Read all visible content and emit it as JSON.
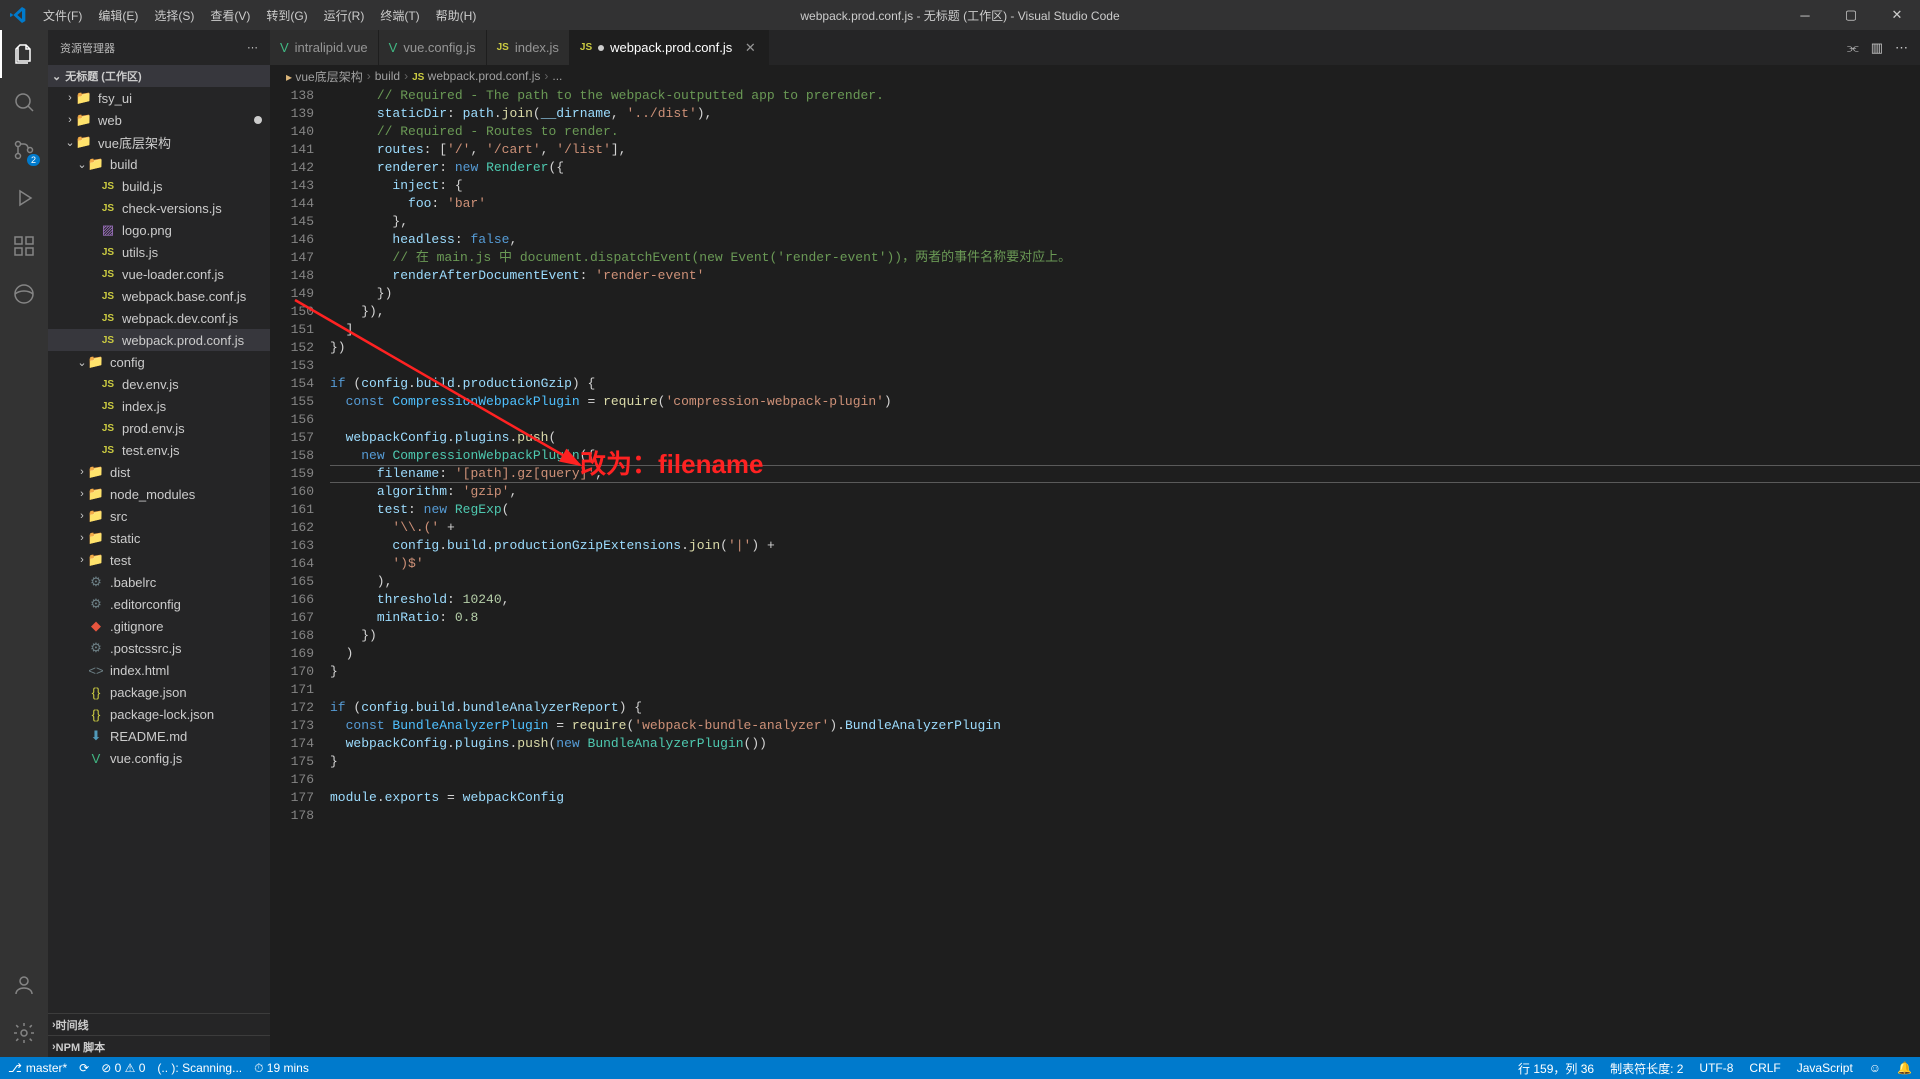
{
  "menubar": [
    "文件(F)",
    "编辑(E)",
    "选择(S)",
    "查看(V)",
    "转到(G)",
    "运行(R)",
    "终端(T)",
    "帮助(H)"
  ],
  "title": "webpack.prod.conf.js - 无标题 (工作区) - Visual Studio Code",
  "sidebar": {
    "header": "资源管理器",
    "section": "无标题 (工作区)",
    "bottom1": "时间线",
    "bottom2": "NPM 脚本"
  },
  "tree": [
    {
      "indent": 1,
      "chev": "›",
      "type": "folder",
      "label": "fsy_ui"
    },
    {
      "indent": 1,
      "chev": "›",
      "type": "folder",
      "label": "web",
      "mod": true
    },
    {
      "indent": 1,
      "chev": "⌄",
      "type": "folder",
      "label": "vue底层架构"
    },
    {
      "indent": 2,
      "chev": "⌄",
      "type": "folder",
      "label": "build"
    },
    {
      "indent": 3,
      "type": "js",
      "label": "build.js"
    },
    {
      "indent": 3,
      "type": "js",
      "label": "check-versions.js"
    },
    {
      "indent": 3,
      "type": "img",
      "label": "logo.png"
    },
    {
      "indent": 3,
      "type": "js",
      "label": "utils.js"
    },
    {
      "indent": 3,
      "type": "js",
      "label": "vue-loader.conf.js"
    },
    {
      "indent": 3,
      "type": "js",
      "label": "webpack.base.conf.js"
    },
    {
      "indent": 3,
      "type": "js",
      "label": "webpack.dev.conf.js"
    },
    {
      "indent": 3,
      "type": "js",
      "label": "webpack.prod.conf.js",
      "active": true
    },
    {
      "indent": 2,
      "chev": "⌄",
      "type": "folder",
      "label": "config"
    },
    {
      "indent": 3,
      "type": "js",
      "label": "dev.env.js"
    },
    {
      "indent": 3,
      "type": "js",
      "label": "index.js"
    },
    {
      "indent": 3,
      "type": "js",
      "label": "prod.env.js"
    },
    {
      "indent": 3,
      "type": "js",
      "label": "test.env.js"
    },
    {
      "indent": 2,
      "chev": "›",
      "type": "folder",
      "label": "dist"
    },
    {
      "indent": 2,
      "chev": "›",
      "type": "folder",
      "label": "node_modules"
    },
    {
      "indent": 2,
      "chev": "›",
      "type": "folder",
      "label": "src"
    },
    {
      "indent": 2,
      "chev": "›",
      "type": "folder",
      "label": "static"
    },
    {
      "indent": 2,
      "chev": "›",
      "type": "folder",
      "label": "test"
    },
    {
      "indent": 2,
      "type": "conf",
      "label": ".babelrc"
    },
    {
      "indent": 2,
      "type": "conf",
      "label": ".editorconfig"
    },
    {
      "indent": 2,
      "type": "git",
      "label": ".gitignore"
    },
    {
      "indent": 2,
      "type": "conf",
      "label": ".postcssrc.js"
    },
    {
      "indent": 2,
      "type": "html",
      "label": "index.html"
    },
    {
      "indent": 2,
      "type": "json",
      "label": "package.json"
    },
    {
      "indent": 2,
      "type": "json",
      "label": "package-lock.json"
    },
    {
      "indent": 2,
      "type": "md",
      "label": "README.md"
    },
    {
      "indent": 2,
      "type": "vue",
      "label": "vue.config.js"
    }
  ],
  "tabs": [
    {
      "icon": "vue",
      "label": "intralipid.vue"
    },
    {
      "icon": "vue",
      "label": "vue.config.js"
    },
    {
      "icon": "js",
      "label": "index.js"
    },
    {
      "icon": "js",
      "label": "webpack.prod.conf.js",
      "active": true,
      "close": true,
      "dot": true
    }
  ],
  "breadcrumbs": [
    "vue底层架构",
    "build",
    "webpack.prod.conf.js",
    "..."
  ],
  "code_start": 138,
  "code": [
    [
      [
        "      ",
        "d"
      ],
      [
        "// Required - The path to the webpack-outputted app to prerender.",
        "comment"
      ]
    ],
    [
      [
        "      ",
        "d"
      ],
      [
        "staticDir",
        "prop"
      ],
      [
        ": ",
        "d"
      ],
      [
        "path",
        "prop"
      ],
      [
        ".",
        "d"
      ],
      [
        "join",
        "func"
      ],
      [
        "(",
        "d"
      ],
      [
        "__dirname",
        "prop"
      ],
      [
        ", ",
        "d"
      ],
      [
        "'../dist'",
        "string"
      ],
      [
        "),",
        "d"
      ]
    ],
    [
      [
        "      ",
        "d"
      ],
      [
        "// Required - Routes to render.",
        "comment"
      ]
    ],
    [
      [
        "      ",
        "d"
      ],
      [
        "routes",
        "prop"
      ],
      [
        ": [",
        "d"
      ],
      [
        "'/'",
        "string"
      ],
      [
        ", ",
        "d"
      ],
      [
        "'/cart'",
        "string"
      ],
      [
        ", ",
        "d"
      ],
      [
        "'/list'",
        "string"
      ],
      [
        "],",
        "d"
      ]
    ],
    [
      [
        "      ",
        "d"
      ],
      [
        "renderer",
        "prop"
      ],
      [
        ": ",
        "d"
      ],
      [
        "new ",
        "keyword"
      ],
      [
        "Renderer",
        "type"
      ],
      [
        "({",
        "d"
      ]
    ],
    [
      [
        "        ",
        "d"
      ],
      [
        "inject",
        "prop"
      ],
      [
        ": {",
        "d"
      ]
    ],
    [
      [
        "          ",
        "d"
      ],
      [
        "foo",
        "prop"
      ],
      [
        ": ",
        "d"
      ],
      [
        "'bar'",
        "string"
      ]
    ],
    [
      [
        "        },",
        "d"
      ]
    ],
    [
      [
        "        ",
        "d"
      ],
      [
        "headless",
        "prop"
      ],
      [
        ": ",
        "d"
      ],
      [
        "false",
        "keyword"
      ],
      [
        ",",
        "d"
      ]
    ],
    [
      [
        "        ",
        "d"
      ],
      [
        "// 在 main.js 中 document.dispatchEvent(new Event('render-event'))，两者的事件名称要对应上。",
        "comment"
      ]
    ],
    [
      [
        "        ",
        "d"
      ],
      [
        "renderAfterDocumentEvent",
        "prop"
      ],
      [
        ": ",
        "d"
      ],
      [
        "'render-event'",
        "string"
      ]
    ],
    [
      [
        "      })",
        "d"
      ]
    ],
    [
      [
        "    }),",
        "d"
      ]
    ],
    [
      [
        "  ]",
        "d"
      ]
    ],
    [
      [
        "})",
        "d"
      ]
    ],
    [
      [
        "",
        "d"
      ]
    ],
    [
      [
        "if ",
        "keyword"
      ],
      [
        "(",
        "d"
      ],
      [
        "config",
        "prop"
      ],
      [
        ".",
        "d"
      ],
      [
        "build",
        "prop"
      ],
      [
        ".",
        "d"
      ],
      [
        "productionGzip",
        "prop"
      ],
      [
        ") {",
        "d"
      ]
    ],
    [
      [
        "  ",
        "d"
      ],
      [
        "const ",
        "keyword"
      ],
      [
        "CompressionWebpackPlugin",
        "const"
      ],
      [
        " = ",
        "d"
      ],
      [
        "require",
        "func"
      ],
      [
        "(",
        "d"
      ],
      [
        "'compression-webpack-plugin'",
        "string"
      ],
      [
        ")",
        "d"
      ]
    ],
    [
      [
        "",
        "d"
      ]
    ],
    [
      [
        "  ",
        "d"
      ],
      [
        "webpackConfig",
        "prop"
      ],
      [
        ".",
        "d"
      ],
      [
        "plugins",
        "prop"
      ],
      [
        ".",
        "d"
      ],
      [
        "push",
        "func"
      ],
      [
        "(",
        "d"
      ]
    ],
    [
      [
        "    ",
        "d"
      ],
      [
        "new ",
        "keyword"
      ],
      [
        "CompressionWebpackPlugin",
        "type"
      ],
      [
        "({",
        "d"
      ]
    ],
    [
      [
        "      ",
        "d"
      ],
      [
        "filename",
        "prop"
      ],
      [
        ": ",
        "d"
      ],
      [
        "'[path].gz[query]'",
        "string"
      ],
      [
        ",",
        "d"
      ]
    ],
    [
      [
        "      ",
        "d"
      ],
      [
        "algorithm",
        "prop"
      ],
      [
        ": ",
        "d"
      ],
      [
        "'gzip'",
        "string"
      ],
      [
        ",",
        "d"
      ]
    ],
    [
      [
        "      ",
        "d"
      ],
      [
        "test",
        "prop"
      ],
      [
        ": ",
        "d"
      ],
      [
        "new ",
        "keyword"
      ],
      [
        "RegExp",
        "type"
      ],
      [
        "(",
        "d"
      ]
    ],
    [
      [
        "        ",
        "d"
      ],
      [
        "'\\\\.(' ",
        "string"
      ],
      [
        "+",
        "d"
      ]
    ],
    [
      [
        "        ",
        "d"
      ],
      [
        "config",
        "prop"
      ],
      [
        ".",
        "d"
      ],
      [
        "build",
        "prop"
      ],
      [
        ".",
        "d"
      ],
      [
        "productionGzipExtensions",
        "prop"
      ],
      [
        ".",
        "d"
      ],
      [
        "join",
        "func"
      ],
      [
        "(",
        "d"
      ],
      [
        "'|'",
        "string"
      ],
      [
        ") +",
        "d"
      ]
    ],
    [
      [
        "        ",
        "d"
      ],
      [
        "')$'",
        "string"
      ]
    ],
    [
      [
        "      ),",
        "d"
      ]
    ],
    [
      [
        "      ",
        "d"
      ],
      [
        "threshold",
        "prop"
      ],
      [
        ": ",
        "d"
      ],
      [
        "10240",
        "number"
      ],
      [
        ",",
        "d"
      ]
    ],
    [
      [
        "      ",
        "d"
      ],
      [
        "minRatio",
        "prop"
      ],
      [
        ": ",
        "d"
      ],
      [
        "0.8",
        "number"
      ]
    ],
    [
      [
        "    })",
        "d"
      ]
    ],
    [
      [
        "  )",
        "d"
      ]
    ],
    [
      [
        "}",
        "d"
      ]
    ],
    [
      [
        "",
        "d"
      ]
    ],
    [
      [
        "if ",
        "keyword"
      ],
      [
        "(",
        "d"
      ],
      [
        "config",
        "prop"
      ],
      [
        ".",
        "d"
      ],
      [
        "build",
        "prop"
      ],
      [
        ".",
        "d"
      ],
      [
        "bundleAnalyzerReport",
        "prop"
      ],
      [
        ") {",
        "d"
      ]
    ],
    [
      [
        "  ",
        "d"
      ],
      [
        "const ",
        "keyword"
      ],
      [
        "BundleAnalyzerPlugin",
        "const"
      ],
      [
        " = ",
        "d"
      ],
      [
        "require",
        "func"
      ],
      [
        "(",
        "d"
      ],
      [
        "'webpack-bundle-analyzer'",
        "string"
      ],
      [
        ").",
        "d"
      ],
      [
        "BundleAnalyzerPlugin",
        "prop"
      ]
    ],
    [
      [
        "  ",
        "d"
      ],
      [
        "webpackConfig",
        "prop"
      ],
      [
        ".",
        "d"
      ],
      [
        "plugins",
        "prop"
      ],
      [
        ".",
        "d"
      ],
      [
        "push",
        "func"
      ],
      [
        "(",
        "d"
      ],
      [
        "new ",
        "keyword"
      ],
      [
        "BundleAnalyzerPlugin",
        "type"
      ],
      [
        "())",
        "d"
      ]
    ],
    [
      [
        "}",
        "d"
      ]
    ],
    [
      [
        "",
        "d"
      ]
    ],
    [
      [
        "module",
        "prop"
      ],
      [
        ".",
        "d"
      ],
      [
        "exports",
        "prop"
      ],
      [
        " = ",
        "d"
      ],
      [
        "webpackConfig",
        "prop"
      ]
    ],
    [
      [
        "",
        "d"
      ]
    ]
  ],
  "highlight_index": 21,
  "annotation": "改为：filename",
  "scm_badge": "2",
  "status": {
    "branch": "master*",
    "sync": "⟳",
    "problems": "⊘ 0  ⚠ 0",
    "scanning": "(.. ): Scanning...",
    "time": "⏱ 19 mins",
    "line": "行 159，列 36",
    "tabsize": "制表符长度: 2",
    "encoding": "UTF-8",
    "eol": "CRLF",
    "lang": "JavaScript",
    "feedback": "☺",
    "bell": "🔔"
  }
}
